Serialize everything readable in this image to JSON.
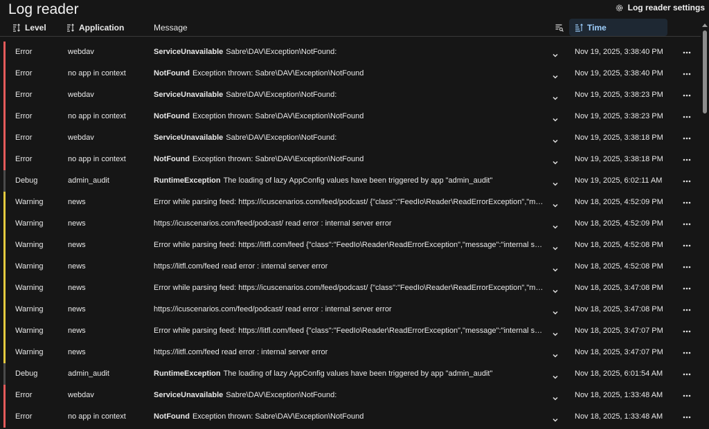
{
  "app": {
    "title": "Log reader",
    "settings_label": "Log reader settings"
  },
  "columns": {
    "level": "Level",
    "application": "Application",
    "message": "Message",
    "time": "Time"
  },
  "colors": {
    "error": "#e45a5a",
    "warning": "#e3c93e",
    "debug": "#4a4a4a",
    "active_sort": "#9fd0ff"
  },
  "rows": [
    {
      "level": "Error",
      "app": "webdav",
      "exception": "ServiceUnavailable",
      "message": "Sabre\\DAV\\Exception\\NotFound:",
      "time": "Nov 19, 2025, 3:38:40 PM"
    },
    {
      "level": "Error",
      "app": "no app in context",
      "exception": "NotFound",
      "message": "Exception thrown: Sabre\\DAV\\Exception\\NotFound",
      "time": "Nov 19, 2025, 3:38:40 PM"
    },
    {
      "level": "Error",
      "app": "webdav",
      "exception": "ServiceUnavailable",
      "message": "Sabre\\DAV\\Exception\\NotFound:",
      "time": "Nov 19, 2025, 3:38:23 PM"
    },
    {
      "level": "Error",
      "app": "no app in context",
      "exception": "NotFound",
      "message": "Exception thrown: Sabre\\DAV\\Exception\\NotFound",
      "time": "Nov 19, 2025, 3:38:23 PM"
    },
    {
      "level": "Error",
      "app": "webdav",
      "exception": "ServiceUnavailable",
      "message": "Sabre\\DAV\\Exception\\NotFound:",
      "time": "Nov 19, 2025, 3:38:18 PM"
    },
    {
      "level": "Error",
      "app": "no app in context",
      "exception": "NotFound",
      "message": "Exception thrown: Sabre\\DAV\\Exception\\NotFound",
      "time": "Nov 19, 2025, 3:38:18 PM"
    },
    {
      "level": "Debug",
      "app": "admin_audit",
      "exception": "RuntimeException",
      "message": "The loading of lazy AppConfig values have been triggered by app \"admin_audit\"",
      "time": "Nov 19, 2025, 6:02:11 AM"
    },
    {
      "level": "Warning",
      "app": "news",
      "exception": "",
      "message": "Error while parsing feed: https://icuscenarios.com/feed/podcast/ {\"class\":\"FeedIo\\Reader\\ReadErrorException\",\"message\":\"internal server error\"}",
      "time": "Nov 18, 2025, 4:52:09 PM"
    },
    {
      "level": "Warning",
      "app": "news",
      "exception": "",
      "message": "https://icuscenarios.com/feed/podcast/ read error : internal server error",
      "time": "Nov 18, 2025, 4:52:09 PM"
    },
    {
      "level": "Warning",
      "app": "news",
      "exception": "",
      "message": "Error while parsing feed: https://litfl.com/feed {\"class\":\"FeedIo\\Reader\\ReadErrorException\",\"message\":\"internal server error\"}",
      "time": "Nov 18, 2025, 4:52:08 PM"
    },
    {
      "level": "Warning",
      "app": "news",
      "exception": "",
      "message": "https://litfl.com/feed read error : internal server error",
      "time": "Nov 18, 2025, 4:52:08 PM"
    },
    {
      "level": "Warning",
      "app": "news",
      "exception": "",
      "message": "Error while parsing feed: https://icuscenarios.com/feed/podcast/ {\"class\":\"FeedIo\\Reader\\ReadErrorException\",\"message\":\"internal server error\"}",
      "time": "Nov 18, 2025, 3:47:08 PM"
    },
    {
      "level": "Warning",
      "app": "news",
      "exception": "",
      "message": "https://icuscenarios.com/feed/podcast/ read error : internal server error",
      "time": "Nov 18, 2025, 3:47:08 PM"
    },
    {
      "level": "Warning",
      "app": "news",
      "exception": "",
      "message": "Error while parsing feed: https://litfl.com/feed {\"class\":\"FeedIo\\Reader\\ReadErrorException\",\"message\":\"internal server error\"}",
      "time": "Nov 18, 2025, 3:47:07 PM"
    },
    {
      "level": "Warning",
      "app": "news",
      "exception": "",
      "message": "https://litfl.com/feed read error : internal server error",
      "time": "Nov 18, 2025, 3:47:07 PM"
    },
    {
      "level": "Debug",
      "app": "admin_audit",
      "exception": "RuntimeException",
      "message": "The loading of lazy AppConfig values have been triggered by app \"admin_audit\"",
      "time": "Nov 18, 2025, 6:01:54 AM"
    },
    {
      "level": "Error",
      "app": "webdav",
      "exception": "ServiceUnavailable",
      "message": "Sabre\\DAV\\Exception\\NotFound:",
      "time": "Nov 18, 2025, 1:33:48 AM"
    },
    {
      "level": "Error",
      "app": "no app in context",
      "exception": "NotFound",
      "message": "Exception thrown: Sabre\\DAV\\Exception\\NotFound",
      "time": "Nov 18, 2025, 1:33:48 AM"
    }
  ]
}
